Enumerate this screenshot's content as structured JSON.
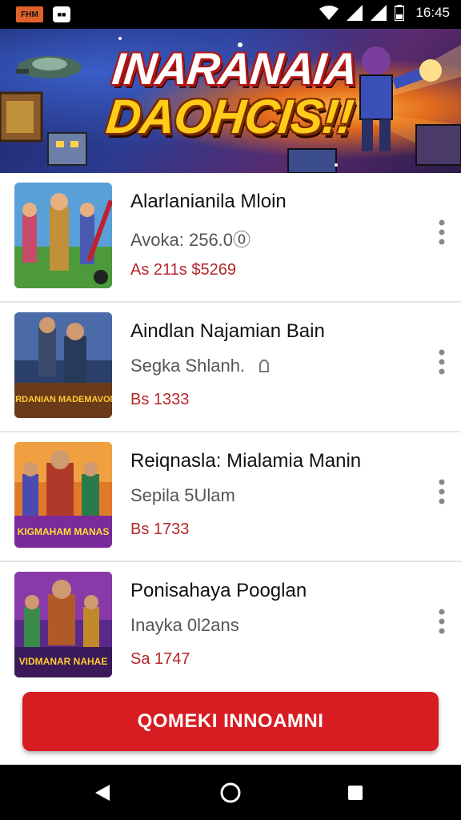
{
  "status_bar": {
    "app_badge_1": "FHM",
    "app_badge_2": "■■",
    "time": "16:45"
  },
  "hero": {
    "title_line_1": "INARANAIA",
    "title_line_2": "DAOHCIS!!"
  },
  "items": [
    {
      "title": "Alarlanianila Mloin",
      "subtitle": "Avoka: 256.0⓪",
      "price": "As 211s $5269"
    },
    {
      "title": "Aindlan Najamian Bain",
      "subtitle": "Segka Shlanh.",
      "price": "Bs 1333",
      "thumb_text": "FERDANIAN MADEMAVONS"
    },
    {
      "title": "Reiqnasla: Mialamia Manin",
      "subtitle": "Sepila 5Ulam",
      "price": "Bs 1733",
      "thumb_text": "KIGMAHAM MANAS"
    },
    {
      "title": "Ponisahaya Pooglan",
      "subtitle": "Inayka 0l2ans",
      "price": "Sa 1747",
      "thumb_text": "VIDMANAR NAHAE"
    }
  ],
  "cta": {
    "label": "QOMEKI INNOAMNI"
  },
  "colors": {
    "accent": "#d71c22",
    "price": "#b3262a"
  }
}
